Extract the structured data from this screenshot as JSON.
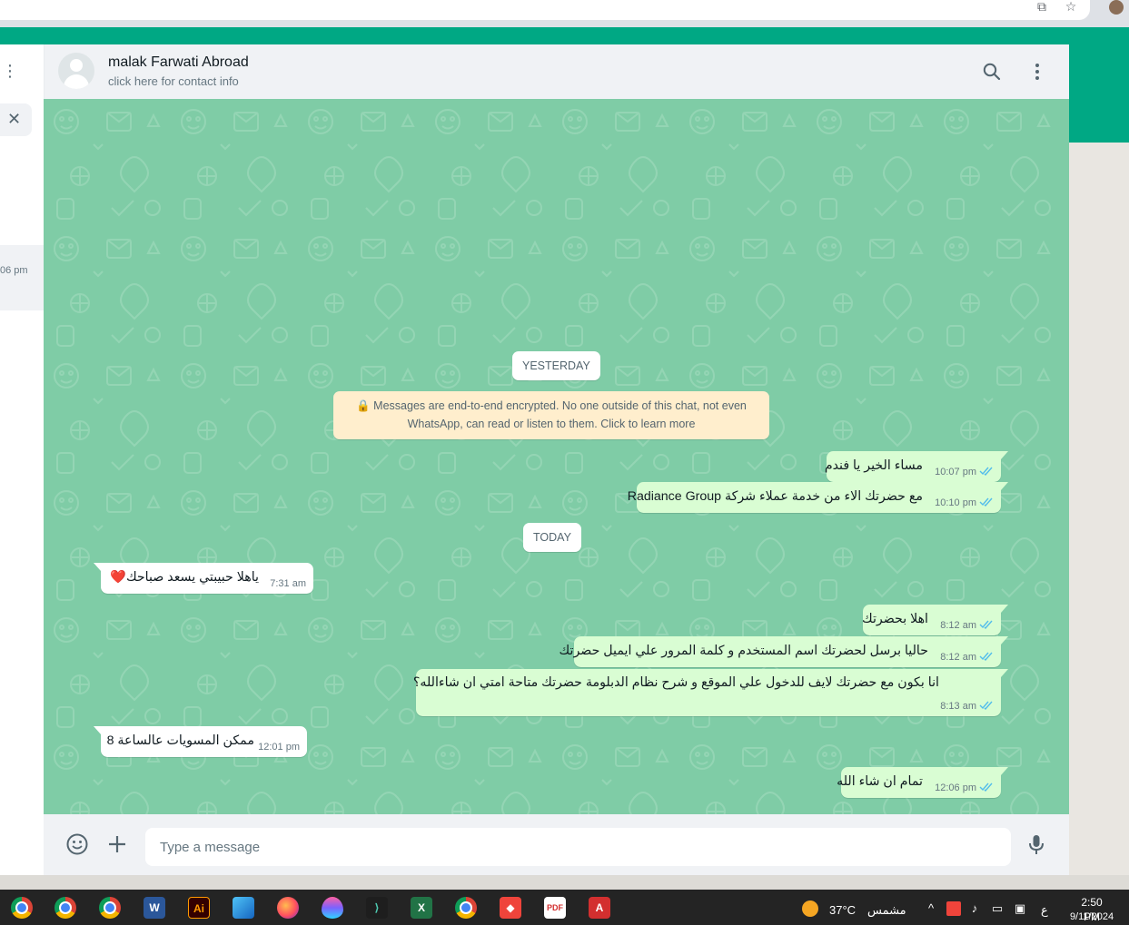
{
  "contact": {
    "name": "malak Farwati Abroad",
    "subtitle": "click here for contact info"
  },
  "left_panel": {
    "chat_time_partial": "06 pm"
  },
  "conversation": {
    "date_yesterday": "YESTERDAY",
    "date_today": "TODAY",
    "encryption_note": "🔒 Messages are end-to-end encrypted. No one outside of this chat, not even WhatsApp, can read or listen to them. Click to learn more",
    "messages": [
      {
        "direction": "outgoing",
        "text": "مساء الخير يا فندم",
        "time": "10:07 pm",
        "status": "read"
      },
      {
        "direction": "outgoing",
        "text": "مع حضرتك الاء من خدمة عملاء شركة Radiance Group",
        "time": "10:10 pm",
        "status": "read"
      },
      {
        "direction": "incoming",
        "text": "ياهلا حبيبتي يسعد صباحك❤️",
        "time": "7:31 am"
      },
      {
        "direction": "outgoing",
        "text": "اهلا بحضرتك",
        "time": "8:12 am",
        "status": "read"
      },
      {
        "direction": "outgoing",
        "text": "حاليا برسل لحضرتك اسم المستخدم و كلمة المرور علي ايميل حضرتك",
        "time": "8:12 am",
        "status": "read"
      },
      {
        "direction": "outgoing",
        "text": "انا بكون مع حضرتك لايف للدخول علي الموقع و شرح نظام الدبلومة حضرتك متاحة امتي ان شاءالله؟",
        "time": "8:13 am",
        "status": "read"
      },
      {
        "direction": "incoming",
        "text": "ممكن المسويات عالساعة 8",
        "time": "12:01 pm"
      },
      {
        "direction": "outgoing",
        "text": "تمام ان شاء الله",
        "time": "12:06 pm",
        "status": "read"
      }
    ]
  },
  "composer": {
    "placeholder": "Type a message",
    "value": ""
  },
  "taskbar": {
    "weather_temp": "37°C",
    "weather_desc": "مشمس",
    "language": "ع",
    "clock_time": "2:50 PM",
    "clock_date": "9/11/2024",
    "apps": [
      "chrome-profile",
      "chrome",
      "chrome-profile-2",
      "word",
      "illustrator",
      "photos",
      "firefox",
      "paint",
      "terminal",
      "excel",
      "chrome-profile-3",
      "anydesk",
      "pdf",
      "acrobat"
    ]
  },
  "colors": {
    "brand_green": "#00a884",
    "wallpaper": "#7fcca6",
    "outgoing_bubble": "#d9fdd3",
    "incoming_bubble": "#ffffff",
    "encryption_bg": "#ffeecd",
    "read_tick": "#53bdeb"
  }
}
